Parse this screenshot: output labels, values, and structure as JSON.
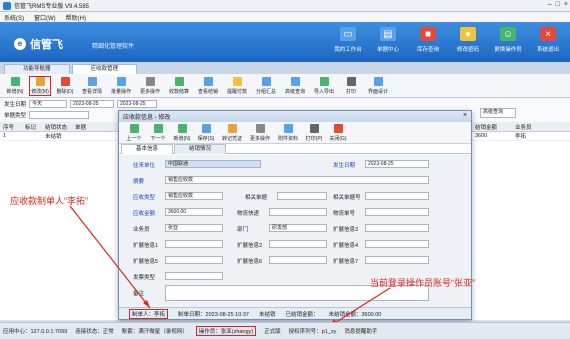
{
  "app": {
    "title": "信管飞RMS专业版 V9.4.585"
  },
  "menu": [
    "系统(S)",
    "窗口(W)",
    "帮助(H)"
  ],
  "brand": {
    "name": "信管飞",
    "tagline": "精细化管理软件"
  },
  "banner_buttons": [
    {
      "label": "我的工作台",
      "icon": "desktop-icon",
      "color": "#5aa0ea"
    },
    {
      "label": "单据中心",
      "icon": "document-icon",
      "color": "#5aa0ea"
    },
    {
      "label": "库存查询",
      "icon": "box-icon",
      "color": "#e04a3a"
    },
    {
      "label": "修改密码",
      "icon": "lock-icon",
      "color": "#f2c23a"
    },
    {
      "label": "更换操作员",
      "icon": "user-switch-icon",
      "color": "#4ab56a"
    },
    {
      "label": "系统退出",
      "icon": "exit-icon",
      "color": "#e04a3a"
    }
  ],
  "tabs": [
    {
      "label": "功能导航器"
    },
    {
      "label": "应收款管理"
    }
  ],
  "toolbar": [
    "新增(N)",
    "修改(M)",
    "删除(D)",
    "查看详情",
    "批量操作",
    "更多操作",
    "收款结算",
    "查看结销",
    "提醒付款",
    "分组汇总",
    "高级查询",
    "导入导出",
    "打印",
    "界面设计"
  ],
  "filter": {
    "date_label": "发生日期",
    "date_preset": "今天",
    "date_value": "2023-08-25",
    "settle_label": "结销状态",
    "type_label": "单据类型",
    "adv_btn": "高级查询"
  },
  "grid": {
    "headers": [
      "序号",
      "标记",
      "结销状态",
      "单据"
    ],
    "right_headers": [
      "结销金额",
      "业务员"
    ],
    "rows": [
      {
        "idx": "1",
        "status": "未结销",
        "amount": "3600",
        "staff": "李拓"
      }
    ]
  },
  "dialog": {
    "title": "应收款信息 - 修改",
    "tools": [
      "上一个",
      "下一个",
      "新增(N)",
      "保存(S)",
      "转记凭证",
      "更多操作",
      "附件资料",
      "打印(P)",
      "关闭(G)"
    ],
    "tabs": [
      "基本信息",
      "结销情况"
    ],
    "fields": {
      "customer_label": "往来单位",
      "customer": "中国联通",
      "date_label": "发生日期",
      "date": "2023-08-25",
      "summary_label": "摘要",
      "summary": "销售应收款",
      "type_label": "应收类型",
      "type": "销售应收款",
      "rel_doc_label": "相关单据",
      "rel_no_label": "相关单据号",
      "amount_label": "应收金额",
      "amount": "3600.00",
      "express_label": "物流快递",
      "express_no_label": "物流单号",
      "staff_label": "业务员",
      "staff": "张亚",
      "dept_label": "部门",
      "dept": "研发部",
      "ext1": "扩展信息1",
      "ext2": "扩展信息2",
      "ext3": "扩展信息3",
      "ext4": "扩展信息4",
      "ext5": "扩展信息5",
      "ext6": "扩展信息6",
      "ext7": "扩展信息7",
      "invoice_label": "发票类型",
      "remark_label": "备注"
    },
    "footer": {
      "maker": "制单人：李拓",
      "make_date": "制单日期：2023-08-25 10:37",
      "status": "未结销",
      "settled": "已结销金额：",
      "unsettled": "未结销金额：3600.00"
    }
  },
  "annotations": {
    "left": "应收款制单人“李拓”",
    "right": "当前登录操作员账号“张亚”"
  },
  "status": {
    "server": "应用中心：127.0.0.1:7099",
    "conn": "连接状态：正常",
    "account": "账套：满汗微星（录视网）",
    "operator": "操作员：张亚(zhangy)",
    "edition": "正式版",
    "license": "授权序列号：p1_zy",
    "msg": "消息提醒助手"
  }
}
